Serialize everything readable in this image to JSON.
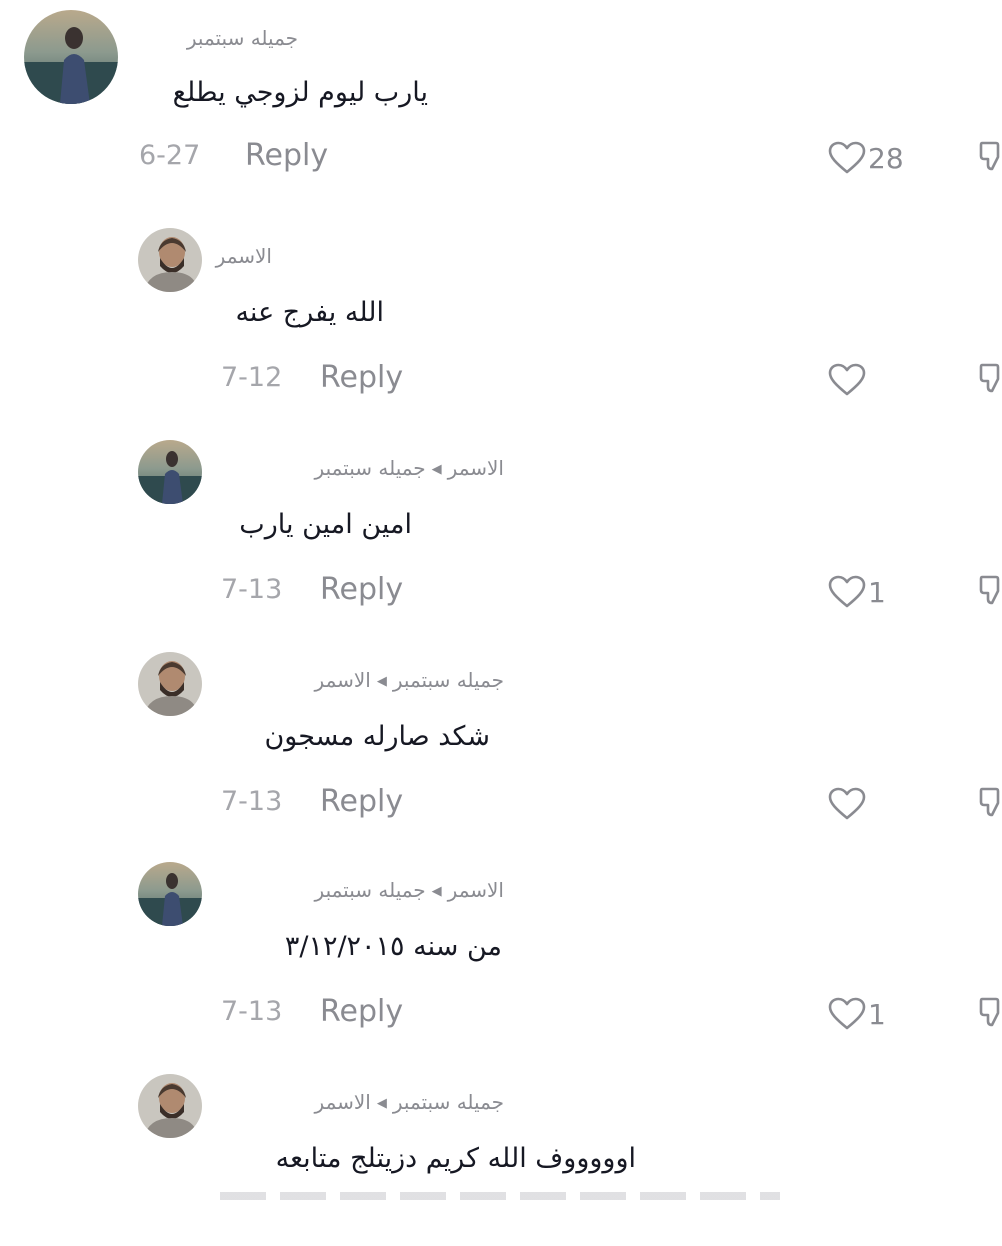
{
  "colors": {
    "text_primary": "#161823",
    "text_secondary": "#8a8b91",
    "date_gray": "#a5a6ab"
  },
  "comments": [
    {
      "author": "جميله سبتمبر",
      "reply_to": "",
      "text": "يارب ليوم لزوجي يطلع",
      "date": "6-27",
      "reply_label": "Reply",
      "likes": "28",
      "avatar": "woman-by-water-avatar",
      "is_reply": false
    },
    {
      "author": "الاسمر",
      "reply_to": "",
      "text": "الله يفرج عنه",
      "date": "7-12",
      "reply_label": "Reply",
      "likes": "",
      "avatar": "bearded-man-avatar",
      "is_reply": true
    },
    {
      "author": "جميله سبتمبر",
      "reply_to": "الاسمر",
      "text": "امين امين يارب",
      "date": "7-13",
      "reply_label": "Reply",
      "likes": "1",
      "avatar": "woman-by-water-avatar",
      "is_reply": true
    },
    {
      "author": "الاسمر",
      "reply_to": "جميله سبتمبر",
      "text": "شكد صارله مسجون",
      "date": "7-13",
      "reply_label": "Reply",
      "likes": "",
      "avatar": "bearded-man-avatar",
      "is_reply": true
    },
    {
      "author": "جميله سبتمبر",
      "reply_to": "الاسمر",
      "text": "من سنه ٣/١٢/٢٠١٥",
      "date": "7-13",
      "reply_label": "Reply",
      "likes": "1",
      "avatar": "woman-by-water-avatar",
      "is_reply": true
    },
    {
      "author": "الاسمر",
      "reply_to": "جميله سبتمبر",
      "text": "اوووووف الله كريم دزيتلج متابعه",
      "date": "",
      "reply_label": "",
      "likes": "",
      "avatar": "bearded-man-avatar",
      "is_reply": true
    }
  ]
}
